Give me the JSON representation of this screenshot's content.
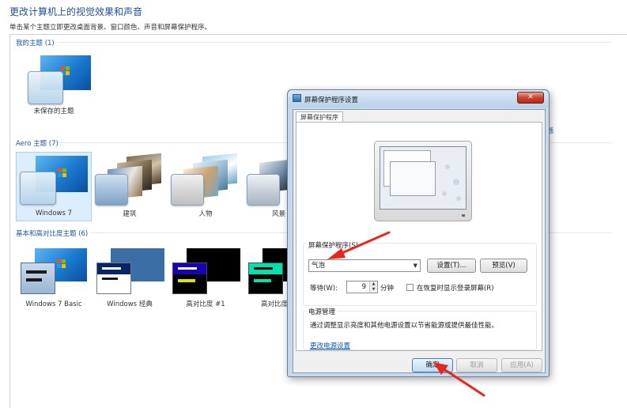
{
  "page": {
    "title": "更改计算机上的视觉效果和声音",
    "description": "单击某个主题立即更改桌面背景、窗口颜色、声音和屏幕保护程序。",
    "edge_link": "题"
  },
  "groups": {
    "my_themes": {
      "title": "我的主题 (1)",
      "items": [
        {
          "label": "未保存的主题"
        }
      ]
    },
    "aero_themes": {
      "title": "Aero 主题 (7)",
      "items": [
        {
          "label": "Windows 7",
          "selected": true
        },
        {
          "label": "建筑"
        },
        {
          "label": "人物"
        },
        {
          "label": "风景"
        }
      ]
    },
    "basic_themes": {
      "title": "基本和高对比度主题 (6)",
      "items": [
        {
          "label": "Windows 7 Basic"
        },
        {
          "label": "Windows 经典"
        },
        {
          "label": "高对比度 #1"
        },
        {
          "label": "高对比度"
        }
      ]
    }
  },
  "dialog": {
    "title": "屏幕保护程序设置",
    "close_label": "✕",
    "tab_label": "屏幕保护程序",
    "screensaver_section": "屏幕保护程序(S)",
    "screensaver_value": "气泡",
    "settings_button": "设置(T)...",
    "preview_button": "预览(V)",
    "wait_label": "等待(W):",
    "wait_value": "9",
    "wait_unit": "分钟",
    "resume_checkbox_label": "在恢复时显示登录屏幕(R)",
    "resume_checked": false,
    "power_section": "电源管理",
    "power_description": "通过调整显示亮度和其他电源设置以节省能源或提供最佳性能。",
    "power_link": "更改电源设置",
    "ok_button": "确定",
    "cancel_button": "取消",
    "apply_button": "应用(A)"
  },
  "colors": {
    "accent_blue": "#1e56a8",
    "annotation_red": "#e8261e",
    "selected_bg": "#dceefe"
  }
}
